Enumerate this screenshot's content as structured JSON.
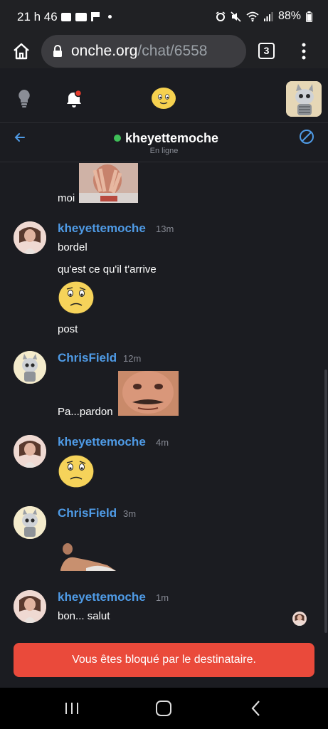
{
  "status_bar": {
    "time": "21 h 46",
    "battery": "88%"
  },
  "browser": {
    "url_host": "onche.org",
    "url_path": "/chat/6558",
    "tab_count": "3"
  },
  "chat": {
    "username": "kheyettemoche",
    "status": "En ligne"
  },
  "messages": [
    {
      "text": "moi"
    },
    {
      "author": "kheyettemoche",
      "time": "13m",
      "lines": [
        "bordel",
        "qu'est ce qu'il t'arrive",
        "post"
      ]
    },
    {
      "author": "ChrisField",
      "time": "12m",
      "text": "Pa...pardon"
    },
    {
      "author": "kheyettemoche",
      "time": "4m"
    },
    {
      "author": "ChrisField",
      "time": "3m"
    },
    {
      "author": "kheyettemoche",
      "time": "1m",
      "text": "bon... salut"
    }
  ],
  "blocked_message": "Vous êtes bloqué par le destinataire.",
  "icons": [
    "home-icon",
    "lock-icon",
    "tabs-icon",
    "more-vert-icon",
    "lightbulb-icon",
    "bell-icon",
    "emoji-logo",
    "back-arrow-icon",
    "block-icon",
    "recent-apps-icon",
    "nav-home-icon",
    "nav-back-icon"
  ],
  "colors": {
    "accent_blue": "#4f9be6",
    "online_green": "#3fbf58",
    "blocked_red": "#ea4a3b",
    "background": "#1b1c21"
  }
}
